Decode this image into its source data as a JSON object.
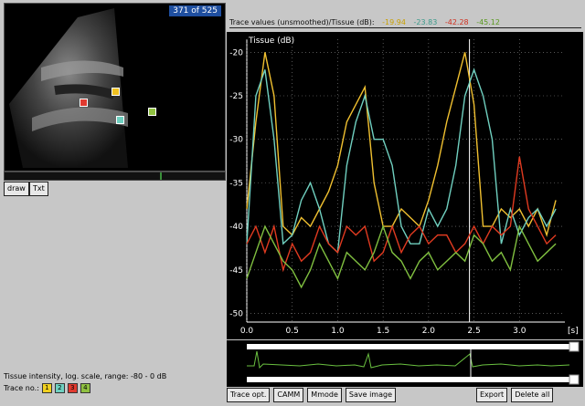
{
  "echo": {
    "frame_counter": "371 of 525",
    "markers": [
      {
        "id": "1",
        "color": "#e03a2f"
      },
      {
        "id": "2",
        "color": "#f0c020"
      },
      {
        "id": "3",
        "color": "#6fd0c0"
      },
      {
        "id": "4",
        "color": "#8fc040"
      }
    ]
  },
  "tools": {
    "draw_label": "draw",
    "txt_label": "Txt"
  },
  "trace_header": {
    "label": "Trace values (unsmoothed)/Tissue (dB):",
    "values": [
      {
        "text": "-19.94",
        "color": "#c9a000"
      },
      {
        "text": "-23.83",
        "color": "#3a9a8a"
      },
      {
        "text": "-42.28",
        "color": "#d0301f"
      },
      {
        "text": "-45.12",
        "color": "#5a9a20"
      }
    ]
  },
  "plot": {
    "y_title": "Tissue (dB)",
    "x_unit": "[s]",
    "y_ticks": [
      "-20",
      "-25",
      "-30",
      "-35",
      "-40",
      "-45",
      "-50"
    ],
    "x_ticks": [
      "0.0",
      "0.5",
      "1.0",
      "1.5",
      "2.0",
      "2.5",
      "3.0"
    ]
  },
  "chart_data": {
    "type": "line",
    "ylim": [
      -51,
      -18.5
    ],
    "xlim": [
      0,
      3.5
    ],
    "grid": true,
    "series": [
      {
        "color": "#f0c030",
        "x": [
          0,
          0.1,
          0.2,
          0.3,
          0.4,
          0.5,
          0.6,
          0.7,
          0.8,
          0.9,
          1.0,
          1.1,
          1.2,
          1.3,
          1.4,
          1.5,
          1.6,
          1.7,
          1.8,
          1.9,
          2.0,
          2.1,
          2.2,
          2.3,
          2.4,
          2.5,
          2.6,
          2.7,
          2.8,
          2.9,
          3.0,
          3.1,
          3.2,
          3.3,
          3.4
        ],
        "y": [
          -38,
          -28,
          -20,
          -25,
          -40,
          -41,
          -39,
          -40,
          -38,
          -36,
          -33,
          -28,
          -26,
          -24,
          -35,
          -40,
          -40,
          -38,
          -39,
          -40,
          -37,
          -33,
          -28,
          -24,
          -20,
          -26,
          -40,
          -40,
          -38,
          -39,
          -38,
          -40,
          -38,
          -41,
          -37
        ]
      },
      {
        "color": "#70d0c0",
        "x": [
          0,
          0.1,
          0.2,
          0.3,
          0.4,
          0.5,
          0.6,
          0.7,
          0.8,
          0.9,
          1.0,
          1.1,
          1.2,
          1.3,
          1.4,
          1.5,
          1.6,
          1.7,
          1.8,
          1.9,
          2.0,
          2.1,
          2.2,
          2.3,
          2.4,
          2.5,
          2.6,
          2.7,
          2.8,
          2.9,
          3.0,
          3.1,
          3.2,
          3.3,
          3.4
        ],
        "y": [
          -42,
          -25,
          -22,
          -30,
          -42,
          -41,
          -37,
          -35,
          -38,
          -42,
          -43,
          -33,
          -28,
          -25,
          -30,
          -30,
          -33,
          -40,
          -42,
          -42,
          -38,
          -40,
          -38,
          -33,
          -25,
          -22,
          -25,
          -30,
          -42,
          -38,
          -41,
          -39,
          -38,
          -40,
          -38
        ]
      },
      {
        "color": "#e03a20",
        "x": [
          0,
          0.1,
          0.2,
          0.3,
          0.4,
          0.5,
          0.6,
          0.7,
          0.8,
          0.9,
          1.0,
          1.1,
          1.2,
          1.3,
          1.4,
          1.5,
          1.6,
          1.7,
          1.8,
          1.9,
          2.0,
          2.1,
          2.2,
          2.3,
          2.4,
          2.5,
          2.6,
          2.7,
          2.8,
          2.9,
          3.0,
          3.1,
          3.2,
          3.3,
          3.4
        ],
        "y": [
          -42,
          -40,
          -43,
          -40,
          -45,
          -42,
          -44,
          -43,
          -40,
          -42,
          -43,
          -40,
          -41,
          -40,
          -44,
          -43,
          -40,
          -43,
          -41,
          -40,
          -42,
          -41,
          -41,
          -43,
          -42,
          -40,
          -42,
          -40,
          -41,
          -40,
          -32,
          -38,
          -40,
          -42,
          -41
        ]
      },
      {
        "color": "#80c040",
        "x": [
          0,
          0.1,
          0.2,
          0.3,
          0.4,
          0.5,
          0.6,
          0.7,
          0.8,
          0.9,
          1.0,
          1.1,
          1.2,
          1.3,
          1.4,
          1.5,
          1.6,
          1.7,
          1.8,
          1.9,
          2.0,
          2.1,
          2.2,
          2.3,
          2.4,
          2.5,
          2.6,
          2.7,
          2.8,
          2.9,
          3.0,
          3.1,
          3.2,
          3.3,
          3.4
        ],
        "y": [
          -46,
          -43,
          -40,
          -42,
          -44,
          -45,
          -47,
          -45,
          -42,
          -44,
          -46,
          -43,
          -44,
          -45,
          -43,
          -40,
          -43,
          -44,
          -46,
          -44,
          -43,
          -45,
          -44,
          -43,
          -44,
          -41,
          -42,
          -44,
          -43,
          -45,
          -40,
          -42,
          -44,
          -43,
          -42
        ]
      }
    ]
  },
  "info": {
    "intensity_text": "Tissue intensity, log. scale, range: -80 - 0 dB",
    "trace_no_label": "Trace no.:"
  },
  "trace_nos": [
    {
      "text": "1",
      "color": "#f0d020"
    },
    {
      "text": "2",
      "color": "#6fd0c0"
    },
    {
      "text": "3",
      "color": "#e03a2f"
    },
    {
      "text": "4",
      "color": "#8fc040"
    }
  ],
  "bottom_buttons": [
    {
      "label": "Trace opt."
    },
    {
      "label": "CAMM"
    },
    {
      "label": "Mmode"
    },
    {
      "label": "Save image"
    },
    {
      "label": "Export"
    },
    {
      "label": "Delete all"
    }
  ]
}
